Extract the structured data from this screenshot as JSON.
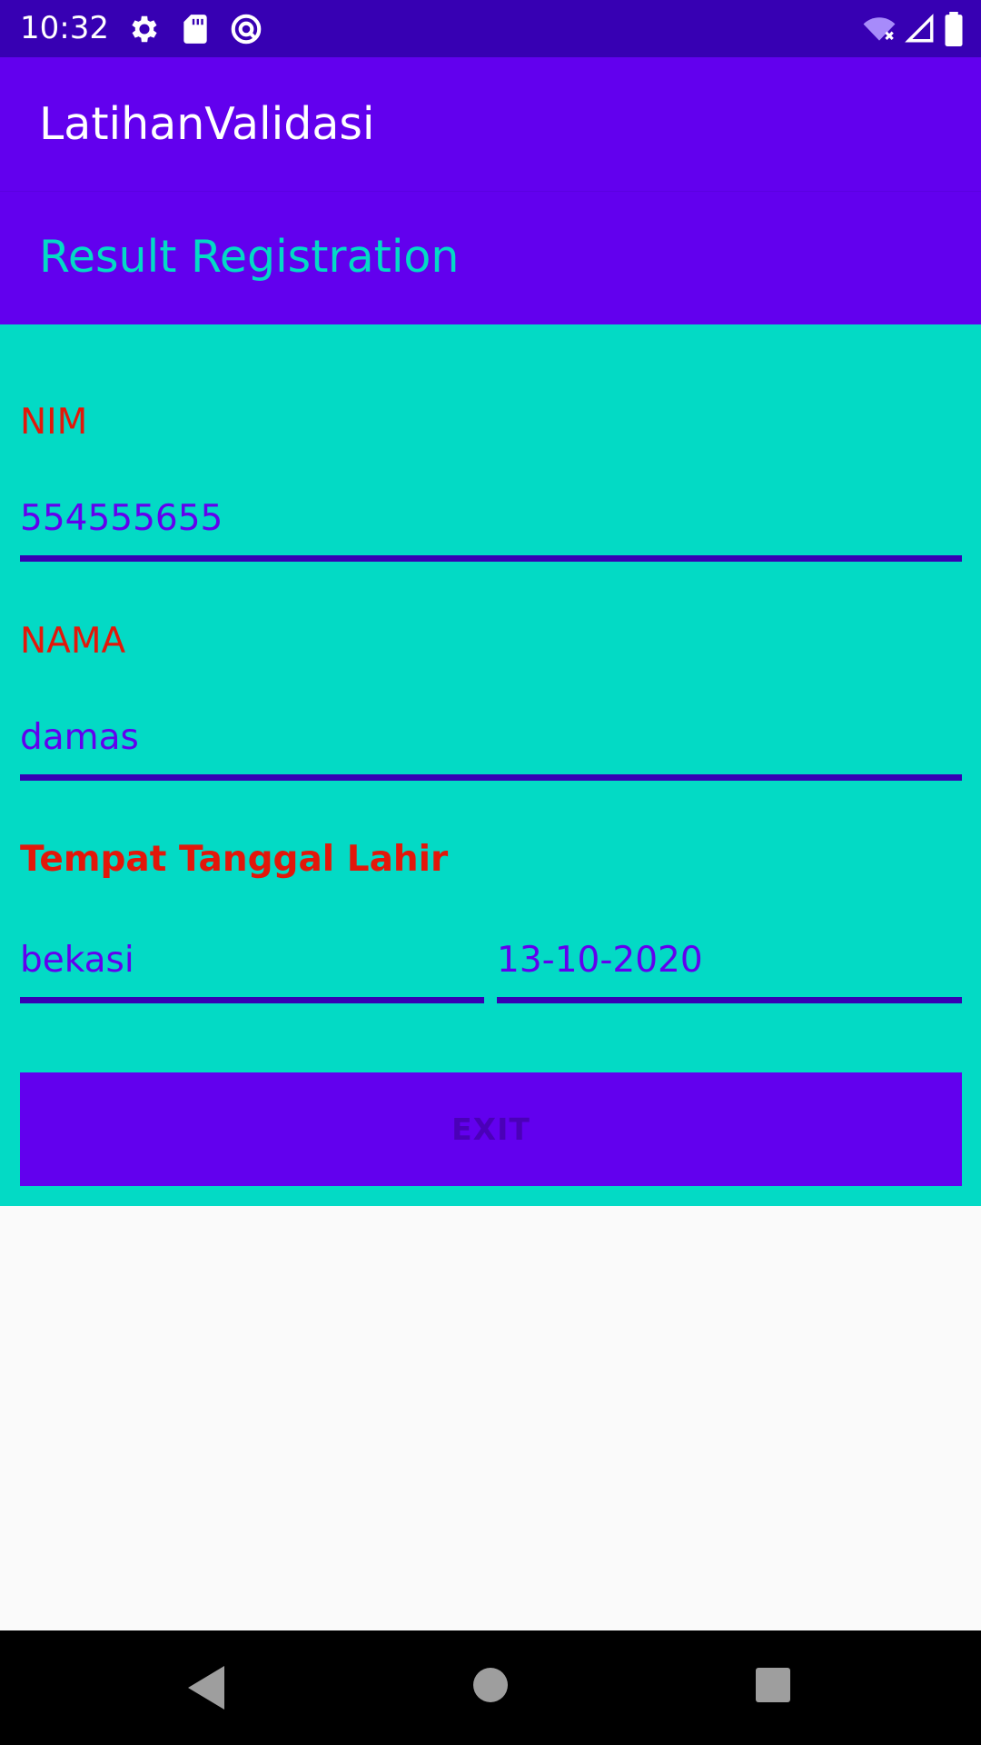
{
  "status_bar": {
    "time": "10:32",
    "icons": [
      "gear-icon",
      "sd-card-icon",
      "no-disturb-icon",
      "wifi-off-icon",
      "signal-icon",
      "battery-icon"
    ]
  },
  "app_bar": {
    "title": "LatihanValidasi"
  },
  "header": {
    "title": "Result Registration"
  },
  "form": {
    "nim_label": "NIM",
    "nim_value": "554555655",
    "nama_label": "NAMA",
    "nama_value": "damas",
    "ttl_label": "Tempat Tanggal Lahir",
    "tempat_value": "bekasi",
    "tanggal_value": "13-10-2020",
    "exit_label": "EXIT"
  },
  "nav_bar": {
    "icons": [
      "back-icon",
      "home-icon",
      "recents-icon"
    ]
  },
  "colors": {
    "status_bar": "#3700b3",
    "primary": "#6200ee",
    "accent": "#03dac5",
    "label_red": "#e3170a",
    "underline": "#3700b3",
    "background": "#fafafa"
  }
}
